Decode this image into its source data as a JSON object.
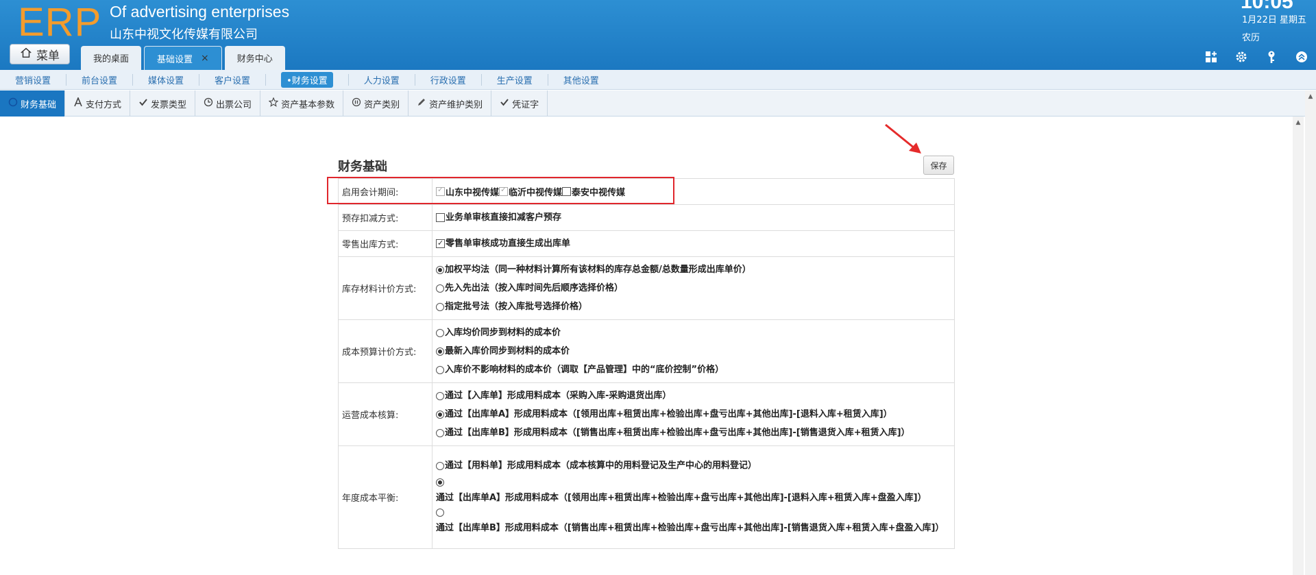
{
  "header": {
    "logo": "ERP",
    "company_en": "Of advertising enterprises",
    "company_cn": "山东中视文化传媒有限公司",
    "time": "10:05",
    "date": "1月22日 星期五",
    "lunar": "农历",
    "menu_label": "菜单",
    "tabs": [
      {
        "label": "我的桌面",
        "active": false
      },
      {
        "label": "基础设置",
        "active": true,
        "close": "×"
      },
      {
        "label": "财务中心",
        "active": false
      }
    ],
    "icons": [
      "grid-add-icon",
      "gear-icon",
      "key-icon",
      "collapse-up-icon"
    ]
  },
  "subnav": [
    "营销设置",
    "前台设置",
    "媒体设置",
    "客户设置",
    "•财务设置",
    "人力设置",
    "行政设置",
    "生产设置",
    "其他设置"
  ],
  "sectabs": [
    {
      "label": "财务基础",
      "icon": "circle-icon",
      "active": true
    },
    {
      "label": "支付方式",
      "icon": "letter-a-icon"
    },
    {
      "label": "发票类型",
      "icon": "check-icon"
    },
    {
      "label": "出票公司",
      "icon": "clock-icon"
    },
    {
      "label": "资产基本参数",
      "icon": "star-icon"
    },
    {
      "label": "资产类别",
      "icon": "pause-icon"
    },
    {
      "label": "资产维护类别",
      "icon": "pencil-icon"
    },
    {
      "label": "凭证字",
      "icon": "check-icon"
    }
  ],
  "main": {
    "title": "财务基础",
    "save_label": "保存",
    "rows": {
      "r1": {
        "label": "启用会计期间:",
        "o1": "山东中视传媒",
        "o2": "临沂中视传媒",
        "o3": "泰安中视传媒"
      },
      "r2": {
        "label": "预存扣减方式:",
        "o1": "业务单审核直接扣减客户预存"
      },
      "r3": {
        "label": "零售出库方式:",
        "o1": "零售单审核成功直接生成出库单"
      },
      "r4": {
        "label": "库存材料计价方式:",
        "o1": "加权平均法（同一种材料计算所有该材料的库存总金额/总数量形成出库单价）",
        "o2": "先入先出法（按入库时间先后顺序选择价格）",
        "o3": "指定批号法（按入库批号选择价格）"
      },
      "r5": {
        "label": "成本预算计价方式:",
        "o1": "入库均价同步到材料的成本价",
        "o2": "最新入库价同步到材料的成本价",
        "o3": "入库价不影响材料的成本价（调取【产品管理】中的“底价控制”价格）"
      },
      "r6": {
        "label": "运营成本核算:",
        "o1": "通过【入库单】形成用料成本（采购入库-采购退货出库）",
        "o2": "通过【出库单A】形成用料成本（[领用出库+租赁出库+检验出库+盘亏出库+其他出库]-[退料入库+租赁入库]）",
        "o3": "通过【出库单B】形成用料成本（[销售出库+租赁出库+检验出库+盘亏出库+其他出库]-[销售退货入库+租赁入库]）"
      },
      "r7": {
        "label": "年度成本平衡:",
        "o1": "通过【用料单】形成用料成本（成本核算中的用料登记及生产中心的用料登记）",
        "o2": "通过【出库单A】形成用料成本（[领用出库+租赁出库+检验出库+盘亏出库+其他出库]-[退料入库+租赁入库+盘盈入库]）",
        "o3": "通过【出库单B】形成用料成本（[销售出库+租赁出库+检验出库+盘亏出库+其他出库]-[销售退货入库+租赁入库+盘盈入库]）"
      }
    }
  },
  "colors": {
    "header": "#1b78c1",
    "logo": "#f39c2d",
    "highlight": "#e0262c"
  }
}
